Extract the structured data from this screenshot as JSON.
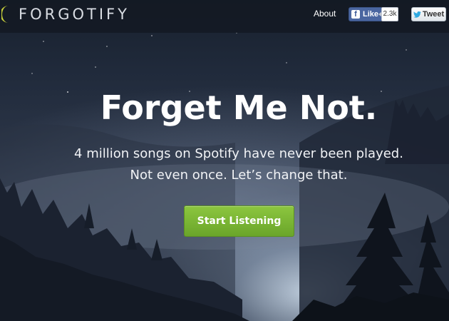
{
  "brand": {
    "name": "FORGOTIFY",
    "logo_icon": "crescent-moon-icon",
    "accent": "#c9d13a"
  },
  "nav": {
    "about_label": "About",
    "facebook": {
      "like_label": "Like",
      "count": "2.3k",
      "icon": "facebook-icon",
      "color": "#4a66a0"
    },
    "twitter": {
      "tweet_label": "Tweet",
      "icon": "twitter-bird-icon"
    }
  },
  "hero": {
    "headline": "Forget Me Not.",
    "subtitle_line1": "4 million songs on Spotify have never been played.",
    "subtitle_line2": "Not even once. Let’s change that.",
    "cta_label": "Start Listening",
    "cta_color": "#7bb635"
  }
}
